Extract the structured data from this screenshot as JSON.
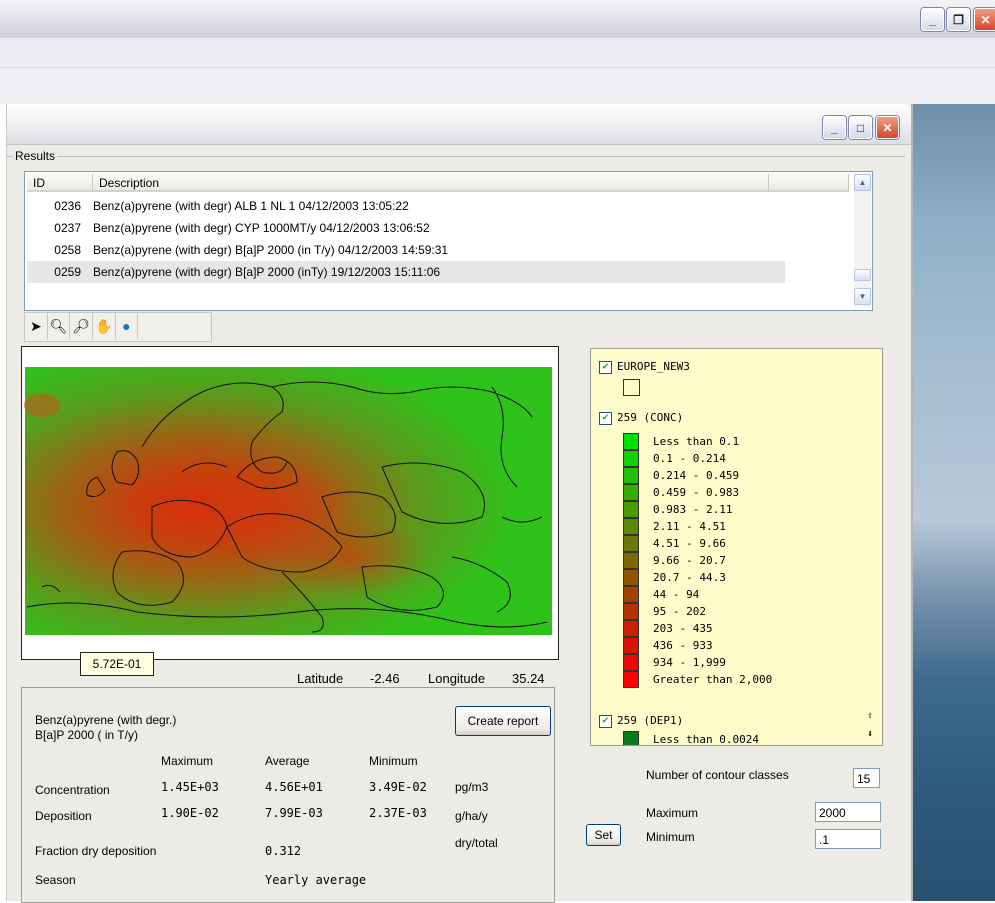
{
  "group_label": "Results",
  "list": {
    "headers": [
      "ID",
      "Description"
    ],
    "rows": [
      {
        "id": "0236",
        "desc": "Benz(a)pyrene (with degr) ALB 1 NL 1 04/12/2003 13:05:22"
      },
      {
        "id": "0237",
        "desc": "Benz(a)pyrene (with degr) CYP 1000MT/y 04/12/2003 13:06:52"
      },
      {
        "id": "0258",
        "desc": "Benz(a)pyrene (with degr) B[a]P 2000 (in T/y) 04/12/2003 14:59:31"
      },
      {
        "id": "0259",
        "desc": "Benz(a)pyrene (with degr) B[a]P 2000 (inTy) 19/12/2003 15:11:06"
      }
    ],
    "selected_index": 3
  },
  "toolbar_icons": [
    "pointer-arrow-icon",
    "zoom-in-icon",
    "zoom-out-icon",
    "pan-hand-icon",
    "globe-icon"
  ],
  "map": {
    "tooltip_value": "5.72E-01",
    "latitude_label": "Latitude",
    "latitude_value": "-2.46",
    "longitude_label": "Longitude",
    "longitude_value": "35.24"
  },
  "legend": {
    "layer1_name": "EUROPE_NEW3",
    "layer2_name": "259  (CONC)",
    "classes": [
      {
        "label": "Less than 0.1",
        "color": "#00e000"
      },
      {
        "label": "0.1 - 0.214",
        "color": "#14d000"
      },
      {
        "label": "0.214 - 0.459",
        "color": "#22c000"
      },
      {
        "label": "0.459 - 0.983",
        "color": "#33ae00"
      },
      {
        "label": "0.983 - 2.11",
        "color": "#489e00"
      },
      {
        "label": "2.11 - 4.51",
        "color": "#5a8a00"
      },
      {
        "label": "4.51 - 9.66",
        "color": "#6a7a00"
      },
      {
        "label": "9.66 - 20.7",
        "color": "#7d6800"
      },
      {
        "label": "20.7 - 44.3",
        "color": "#8e5600"
      },
      {
        "label": "44 - 94",
        "color": "#a24400"
      },
      {
        "label": "95 - 202",
        "color": "#b43300"
      },
      {
        "label": "203 - 435",
        "color": "#c82200"
      },
      {
        "label": "436 - 933",
        "color": "#d81400"
      },
      {
        "label": "934 - 1,999",
        "color": "#ec0800"
      },
      {
        "label": "Greater than 2,000",
        "color": "#ff0000"
      }
    ],
    "layer3_name": "259  (DEP1)",
    "layer3_first_class": "Less than 0.0024",
    "layer3_first_color": "#0a7a1a"
  },
  "info": {
    "substance": "Benz(a)pyrene (with degr.)",
    "scenario": "B[a]P 2000 ( in T/y)",
    "create_report_label": "Create report",
    "col_max": "Maximum",
    "col_avg": "Average",
    "col_min": "Minimum",
    "concentration_label": "Concentration",
    "conc_max": "1.45E+03",
    "conc_avg": "4.56E+01",
    "conc_min": "3.49E-02",
    "conc_unit": "pg/m3",
    "deposition_label": "Deposition",
    "dep_max": "1.90E-02",
    "dep_avg": "7.99E-03",
    "dep_min": "2.37E-03",
    "dep_unit": "g/ha/y",
    "dry_total_label": "dry/total",
    "fraction_label": "Fraction dry deposition",
    "fraction_value": "0.312",
    "season_label": "Season",
    "season_value": "Yearly average"
  },
  "contour": {
    "num_classes_label": "Number of contour classes",
    "num_classes_value": "15",
    "maximum_label": "Maximum",
    "maximum_value": "2000",
    "minimum_label": "Minimum",
    "minimum_value": ".1",
    "set_label": "Set"
  },
  "colors": {
    "map_green": "#2fc21b",
    "map_red": "#d83a10",
    "legend_bg": "#fffccc"
  }
}
